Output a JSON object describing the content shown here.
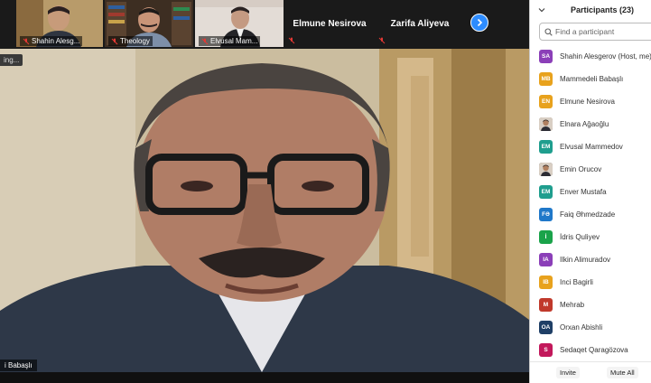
{
  "thumbnails": [
    {
      "name": "Shahin Alesg..."
    },
    {
      "name": "Theology"
    },
    {
      "name": "Elvusal Mam..."
    }
  ],
  "text_tiles": [
    {
      "name": "Elmune Nesirova"
    },
    {
      "name": "Zarifa Aliyeva"
    }
  ],
  "main": {
    "tag": "ing...",
    "speaker_name": "i Babaşlı"
  },
  "panel": {
    "title": "Participants (23)",
    "search_placeholder": "Find a participant",
    "participants": [
      {
        "initials": "SA",
        "color": "#8b3fb8",
        "name": "Shahin Alesgerov (Host, me)"
      },
      {
        "initials": "MB",
        "color": "#e8a21d",
        "name": "Mammedeli Babaşlı"
      },
      {
        "initials": "EN",
        "color": "#e8a21d",
        "name": "Elmune Nesirova"
      },
      {
        "initials": "",
        "color": "#7a5a40",
        "name": "Elnara Ağaoğlu",
        "photo": true
      },
      {
        "initials": "EM",
        "color": "#1f9e8e",
        "name": "Elvusal Mammedov"
      },
      {
        "initials": "",
        "color": "#4a4a4a",
        "name": "Emin Orucov",
        "photo": true
      },
      {
        "initials": "EM",
        "color": "#1f9e8e",
        "name": "Enver Mustafa"
      },
      {
        "initials": "FƏ",
        "color": "#1f78c9",
        "name": "Faiq Əhmedzade"
      },
      {
        "initials": "İ",
        "color": "#1aa34a",
        "name": "İdris Quliyev"
      },
      {
        "initials": "IA",
        "color": "#8b3fb8",
        "name": "Ilkin Alimuradov"
      },
      {
        "initials": "IB",
        "color": "#e8a21d",
        "name": "Inci Bagirli"
      },
      {
        "initials": "M",
        "color": "#c0392b",
        "name": "Mehrab"
      },
      {
        "initials": "OA",
        "color": "#1f3f66",
        "name": "Orxan Abishli"
      },
      {
        "initials": "S",
        "color": "#c2185b",
        "name": "Sedaqet Qaragözova"
      }
    ],
    "invite_label": "Invite",
    "mute_all_label": "Mute All"
  }
}
